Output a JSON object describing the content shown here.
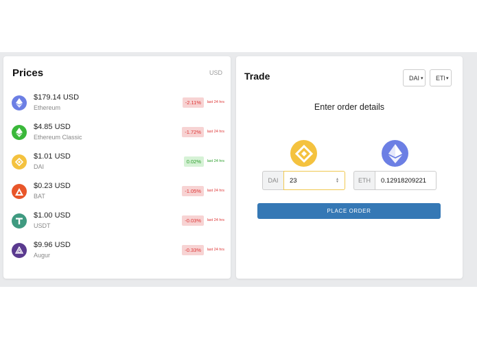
{
  "prices": {
    "title": "Prices",
    "currency": "USD",
    "items": [
      {
        "price": "$179.14 USD",
        "name": "Ethereum",
        "change": "-2.11%",
        "period": "last 24 hrs",
        "trend": "neg",
        "icon": "ethereum-icon",
        "color": "#6c7fe4"
      },
      {
        "price": "$4.85 USD",
        "name": "Ethereum Classic",
        "change": "-1.72%",
        "period": "last 24 hrs",
        "trend": "neg",
        "icon": "ethereum-classic-icon",
        "color": "#3ab83a"
      },
      {
        "price": "$1.01 USD",
        "name": "DAI",
        "change": "0.02%",
        "period": "last 24 hrs",
        "trend": "pos",
        "icon": "dai-icon",
        "color": "#f4c23f"
      },
      {
        "price": "$0.23 USD",
        "name": "BAT",
        "change": "-1.05%",
        "period": "last 24 hrs",
        "trend": "neg",
        "icon": "bat-icon",
        "color": "#e8562a"
      },
      {
        "price": "$1.00 USD",
        "name": "USDT",
        "change": "-0.03%",
        "period": "last 24 hrs",
        "trend": "neg",
        "icon": "tether-icon",
        "color": "#3f9a80"
      },
      {
        "price": "$9.96 USD",
        "name": "Augur",
        "change": "-0.33%",
        "period": "last 24 hrs",
        "trend": "neg",
        "icon": "augur-icon",
        "color": "#5a3a8f"
      }
    ]
  },
  "trade": {
    "title": "Trade",
    "from_select": "DAI",
    "to_select": "ETH",
    "heading": "Enter order details",
    "from": {
      "symbol": "DAI",
      "value": "23"
    },
    "to": {
      "symbol": "ETH",
      "value": "0.12918209221"
    },
    "button": "PLACE ORDER"
  }
}
